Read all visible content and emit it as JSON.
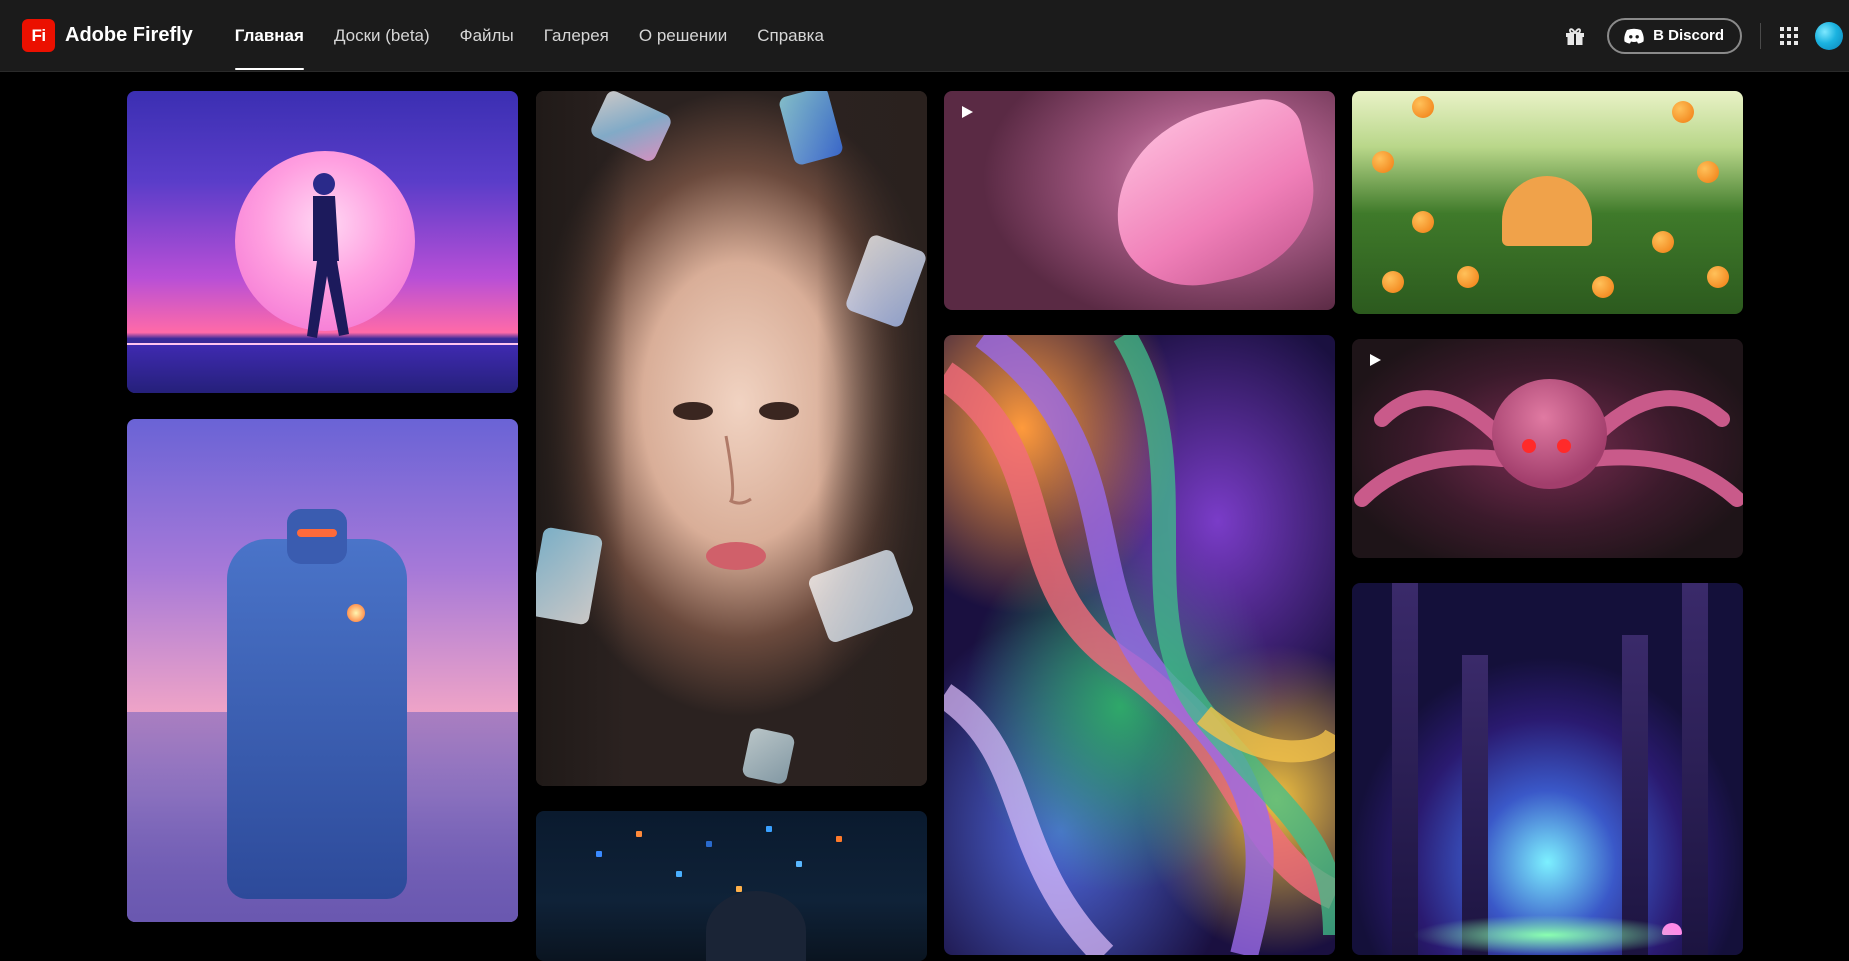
{
  "app": {
    "logo_text": "Fi",
    "name": "Adobe Firefly"
  },
  "nav": {
    "items": [
      {
        "label": "Главная",
        "active": true
      },
      {
        "label": "Доски (beta)",
        "active": false
      },
      {
        "label": "Файлы",
        "active": false
      },
      {
        "label": "Галерея",
        "active": false
      },
      {
        "label": "О решении",
        "active": false
      },
      {
        "label": "Справка",
        "active": false
      }
    ]
  },
  "header": {
    "discord_label": "В Discord",
    "icons": [
      "gift-icon",
      "discord-icon",
      "apps-grid-icon",
      "avatar"
    ]
  },
  "gallery": {
    "tiles": [
      {
        "name": "tile-moon-walker",
        "is_video": false
      },
      {
        "name": "tile-crystal-portrait",
        "is_video": false
      },
      {
        "name": "tile-pink-butterfly",
        "is_video": true
      },
      {
        "name": "tile-orange-grove",
        "is_video": false
      },
      {
        "name": "tile-blue-robot",
        "is_video": false
      },
      {
        "name": "tile-flowing-waves",
        "is_video": false
      },
      {
        "name": "tile-pink-spider",
        "is_video": true
      },
      {
        "name": "tile-glowing-forest",
        "is_video": false
      },
      {
        "name": "tile-night-city",
        "is_video": false
      }
    ]
  },
  "colors": {
    "header_bg": "#1b1b1b",
    "page_bg": "#000000",
    "brand_red": "#eb1000",
    "avatar": "#1bb3e0"
  }
}
